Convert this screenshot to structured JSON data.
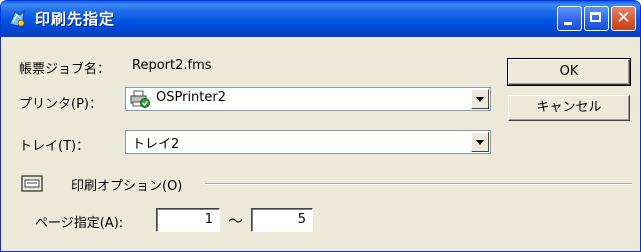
{
  "window": {
    "title": "印刷先指定",
    "controls": {
      "minimize_icon": "minimize-icon",
      "maximize_icon": "maximize-icon",
      "close_label": "✕"
    }
  },
  "form": {
    "report_name_label": "帳票ジョブ名：",
    "report_name_value": "Report2.fms",
    "printer_label": "プリンタ(P)：",
    "printer_value": "OSPrinter2",
    "printer_icon": "printer-ready-icon",
    "tray_label": "トレイ(T)：",
    "tray_value": "トレイ2",
    "print_options_label": "印刷オプション(O)",
    "print_options_icon": "print-options-icon",
    "page_range_label": "ページ指定(A):",
    "page_from": "1",
    "page_range_separator": "〜",
    "page_to": "5"
  },
  "buttons": {
    "ok": "OK",
    "cancel": "キャンセル"
  },
  "colors": {
    "titlebar": "#0055e5",
    "dialog_bg": "#ece9d8",
    "close_button": "#d45a33"
  }
}
